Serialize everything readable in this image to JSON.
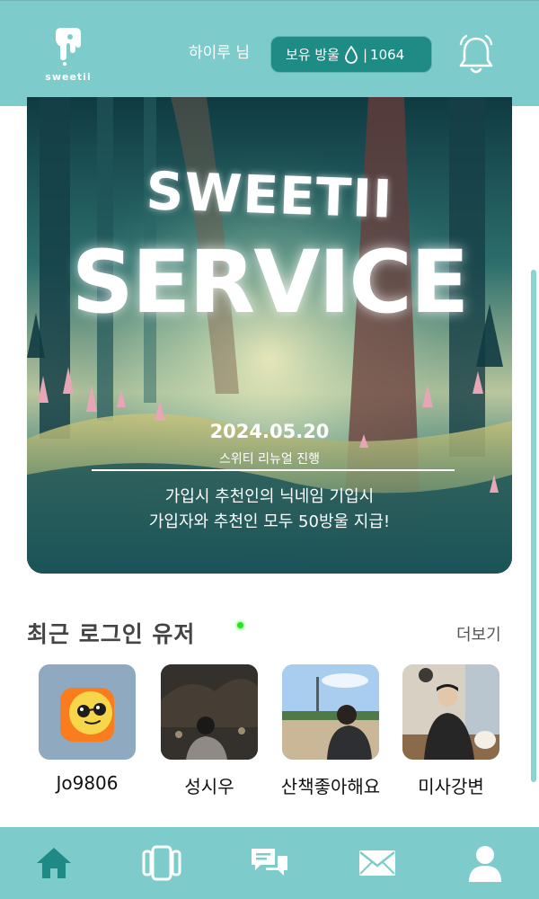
{
  "header": {
    "logo_text": "sweetii",
    "greeting": "하이루 님",
    "drops": {
      "label": "보유 방울",
      "separator": "|",
      "count": "1064"
    },
    "icons": [
      "drop-icon",
      "bell-icon"
    ]
  },
  "banner": {
    "title_line1": "SWEETII",
    "title_line2": "SERVICE",
    "date": "2024.05.20",
    "subtitle": "스위티 리뉴얼 진행",
    "message_line1": "가입시 추천인의 닉네임 기입시",
    "message_line2": "가입자와 추천인 모두 50방울 지급!"
  },
  "recent_users": {
    "title": "최근 로그인 유저",
    "more_label": "더보기",
    "users": [
      {
        "name": "Jo9806"
      },
      {
        "name": "성시우"
      },
      {
        "name": "산책좋아해요"
      },
      {
        "name": "미사강변"
      }
    ]
  },
  "nav": {
    "items": [
      "home-icon",
      "cards-icon",
      "chat-icon",
      "mail-icon",
      "profile-icon"
    ]
  },
  "colors": {
    "header_bg": "#7dcccb",
    "pill_bg": "#1e8b85",
    "nav_icon": "#1f8a85",
    "online": "#25e61f"
  }
}
